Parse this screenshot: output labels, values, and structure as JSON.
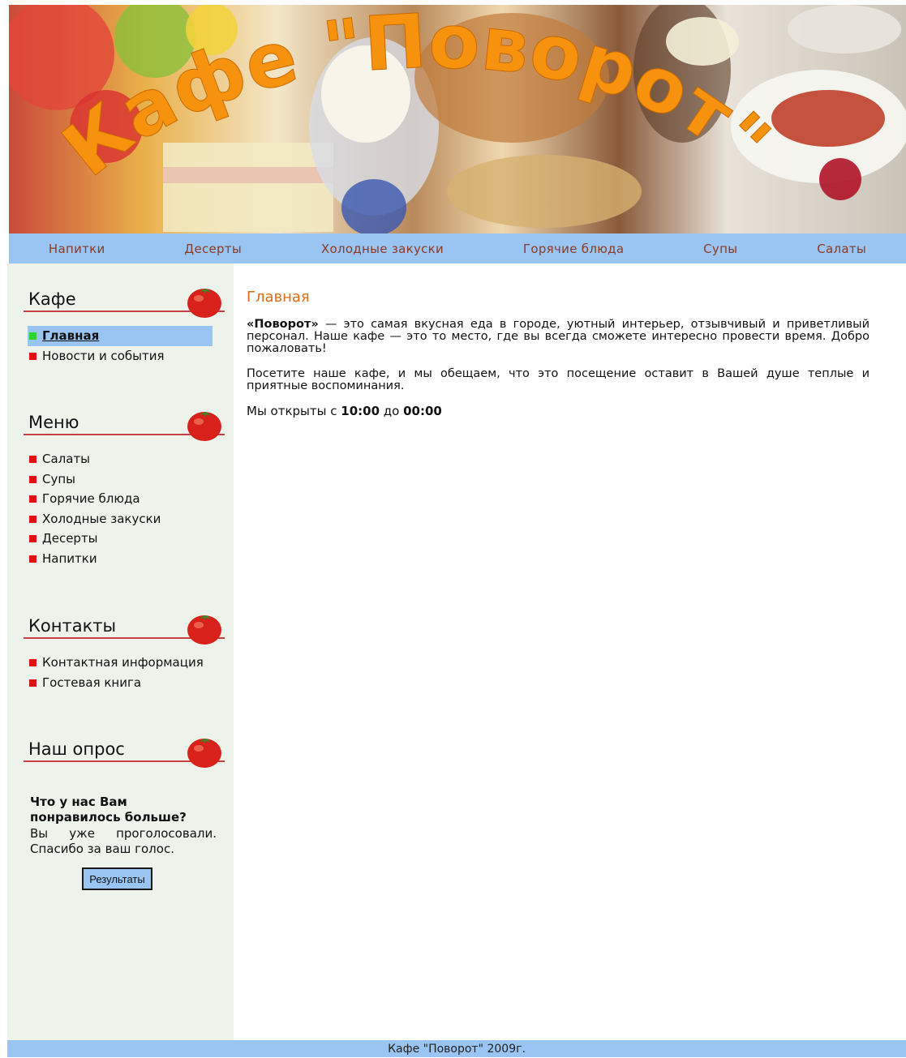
{
  "banner": {
    "title": "Кафе \"Поворот\"",
    "title_color": "#f7920f"
  },
  "topnav": {
    "items": [
      "Напитки",
      "Десерты",
      "Холодные закуски",
      "Горячие блюда",
      "Супы",
      "Салаты"
    ]
  },
  "sidebar": {
    "cafe": {
      "title": "Кафе",
      "items": [
        "Главная",
        "Новости и события"
      ],
      "active": "Главная"
    },
    "menu": {
      "title": "Меню",
      "items": [
        "Салаты",
        "Супы",
        "Горячие блюда",
        "Холодные закуски",
        "Десерты",
        "Напитки"
      ]
    },
    "contacts": {
      "title": "Контакты",
      "items": [
        "Контактная информация",
        "Гостевая книга"
      ]
    },
    "poll": {
      "title": "Наш опрос",
      "question": "Что у нас Вам понравилось больше?",
      "status": "Вы уже проголосовали. Спасибо за ваш голос.",
      "results_button": "Результаты"
    }
  },
  "main": {
    "heading": "Главная",
    "p1_brand": "«Поворот»",
    "p1_text": " — это самая вкусная еда в городе, уютный интерьер, отзывчивый и приветливый персонал. Наше кафе — это то место, где вы всегда сможете интересно провести время. Добро пожаловать!",
    "p2": "Посетите наше кафе, и мы обещаем, что это посещение оставит в Вашей душе теплые и приятные воспоминания.",
    "hours_prefix": "Мы открыты с ",
    "hours_open": "10:00",
    "hours_mid": " до ",
    "hours_close": "00:00"
  },
  "footer": {
    "text": "Кафе \"Поворот\" 2009г."
  },
  "colors": {
    "nav_bg": "#9ac4f2",
    "sidebar_bg": "#edf2ea",
    "bullet": "#e01010",
    "active_bullet": "#2fd22f",
    "heading": "#e36a10",
    "nav_link": "#8b3a24"
  }
}
